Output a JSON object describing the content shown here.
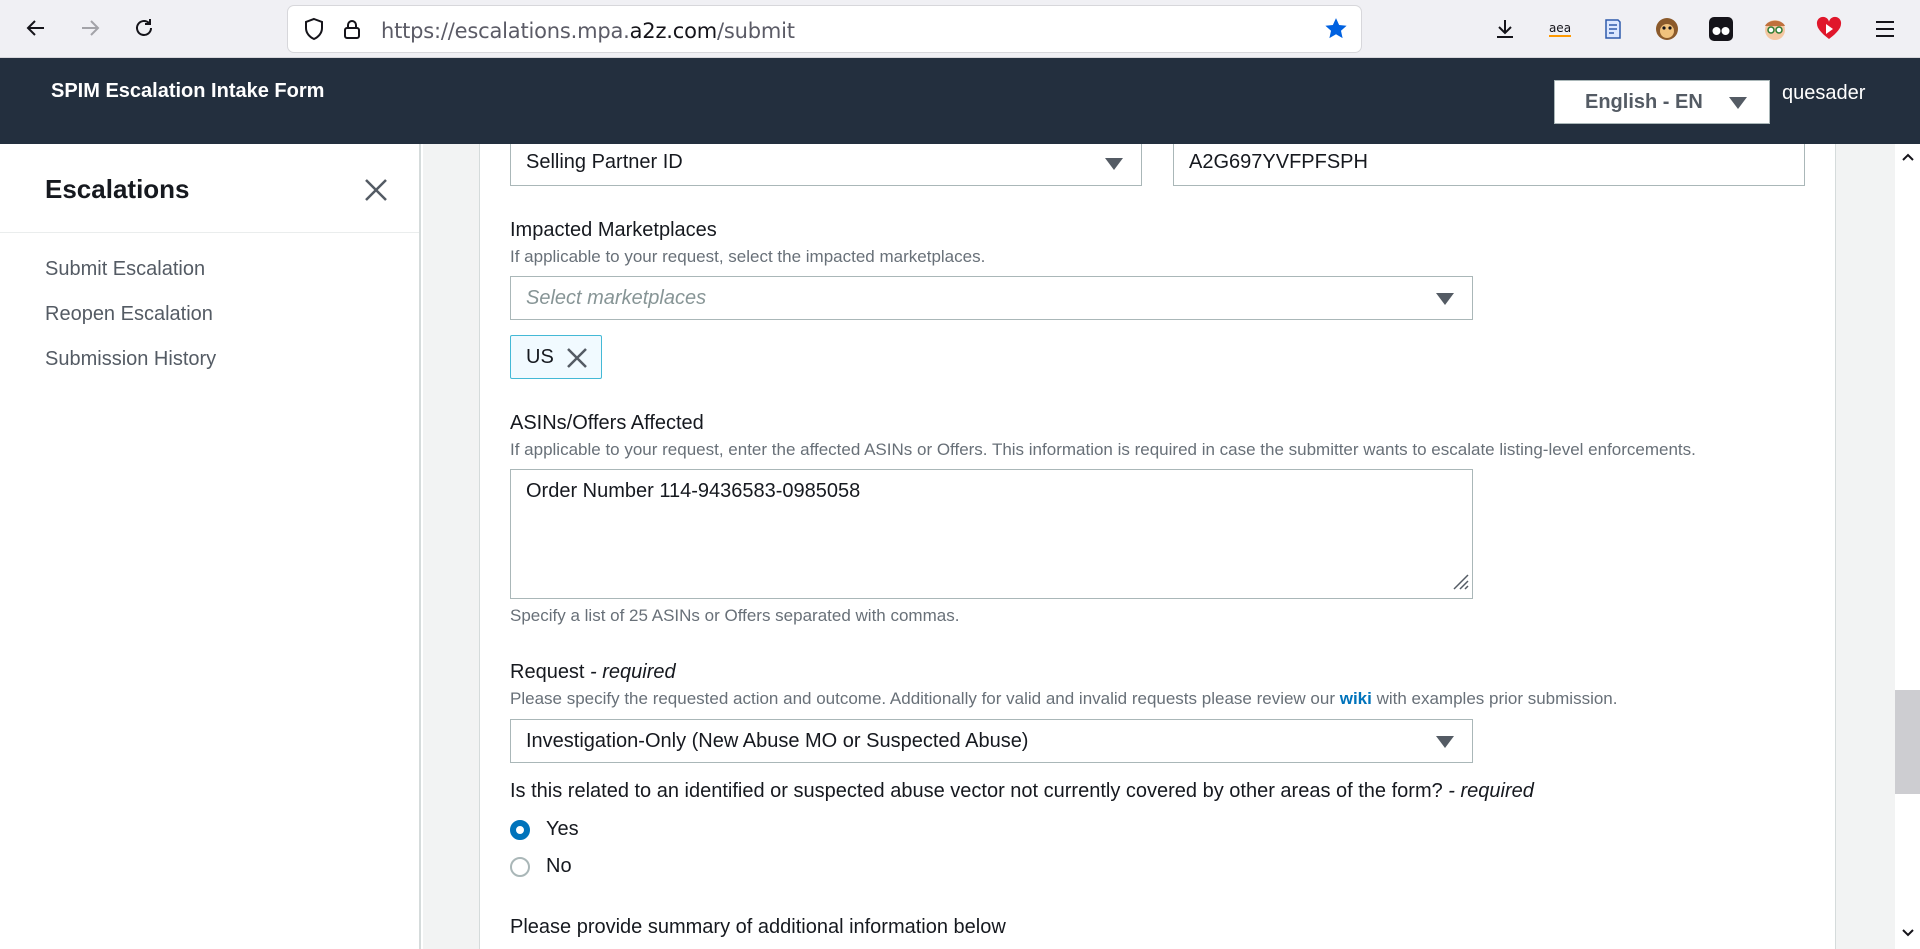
{
  "browser": {
    "url_prefix": "https://escalations.mpa.",
    "url_domain": "a2z.com",
    "url_path": "/submit",
    "icons": [
      "back-icon",
      "forward-icon",
      "reload-icon",
      "shield-icon",
      "lock-icon",
      "bookmark-star-icon",
      "download-icon",
      "amazon-extension-icon",
      "reader-icon",
      "monkey-extension-icon",
      "eyes-extension-icon",
      "face-extension-icon",
      "red-heart-extension-icon",
      "menu-icon"
    ],
    "extension_aea_label": "aea"
  },
  "header": {
    "title": "SPIM Escalation Intake Form",
    "language": "English - EN",
    "username": "quesader"
  },
  "sidebar": {
    "title": "Escalations",
    "items": [
      {
        "label": "Submit Escalation"
      },
      {
        "label": "Reopen Escalation"
      },
      {
        "label": "Submission History"
      }
    ]
  },
  "form": {
    "id_type": {
      "value": "Selling Partner ID"
    },
    "id_value": {
      "value": "A2G697YVFPFSPH"
    },
    "marketplaces": {
      "label": "Impacted Marketplaces",
      "description": "If applicable to your request, select the impacted marketplaces.",
      "placeholder": "Select marketplaces",
      "selected": [
        "US"
      ]
    },
    "asins": {
      "label": "ASINs/Offers Affected",
      "description": "If applicable to your request, enter the affected ASINs or Offers. This information is required in case the submitter wants to escalate listing-level enforcements.",
      "value": "Order Number 114-9436583-0985058",
      "hint": "Specify a list of 25 ASINs or Offers separated with commas."
    },
    "request": {
      "label": "Request",
      "required_text": " - required",
      "description_before": "Please specify the requested action and outcome. Additionally for valid and invalid requests please review our ",
      "link_text": "wiki",
      "description_after": " with examples prior submission.",
      "value": "Investigation-Only (New Abuse MO or Suspected Abuse)"
    },
    "abuse_vector": {
      "question": "Is this related to an identified or suspected abuse vector not currently covered by other areas of the form?",
      "required_text": " - required",
      "options": [
        {
          "label": "Yes",
          "checked": true
        },
        {
          "label": "No",
          "checked": false
        }
      ]
    },
    "summary": {
      "label": "Please provide summary of additional information below"
    }
  },
  "colors": {
    "header_bg": "#232f3e",
    "accent": "#0073bb",
    "token_border": "#44b9d6"
  }
}
